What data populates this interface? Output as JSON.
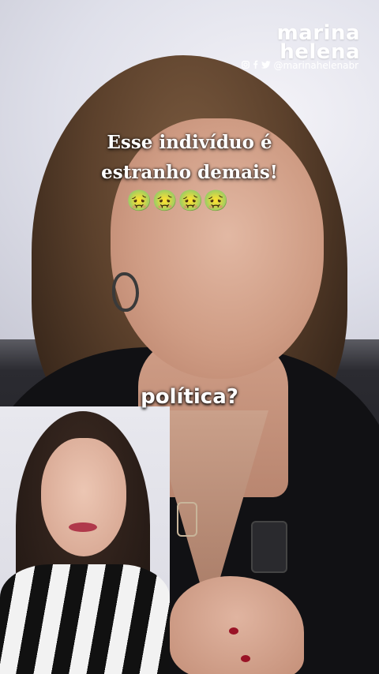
{
  "brand": {
    "line1": "marina",
    "line2": "helena"
  },
  "social": {
    "icons": [
      "instagram-icon",
      "facebook-icon",
      "twitter-icon"
    ],
    "handle": "@marinahelenabr"
  },
  "caption": {
    "line1": "Esse indivíduo é",
    "line2": "estranho demais!",
    "emojis": "🤢🤢🤢🤢"
  },
  "subtitle": "política?",
  "colors": {
    "caption_text": "#ffffff",
    "nail_polish": "#9a1326"
  }
}
